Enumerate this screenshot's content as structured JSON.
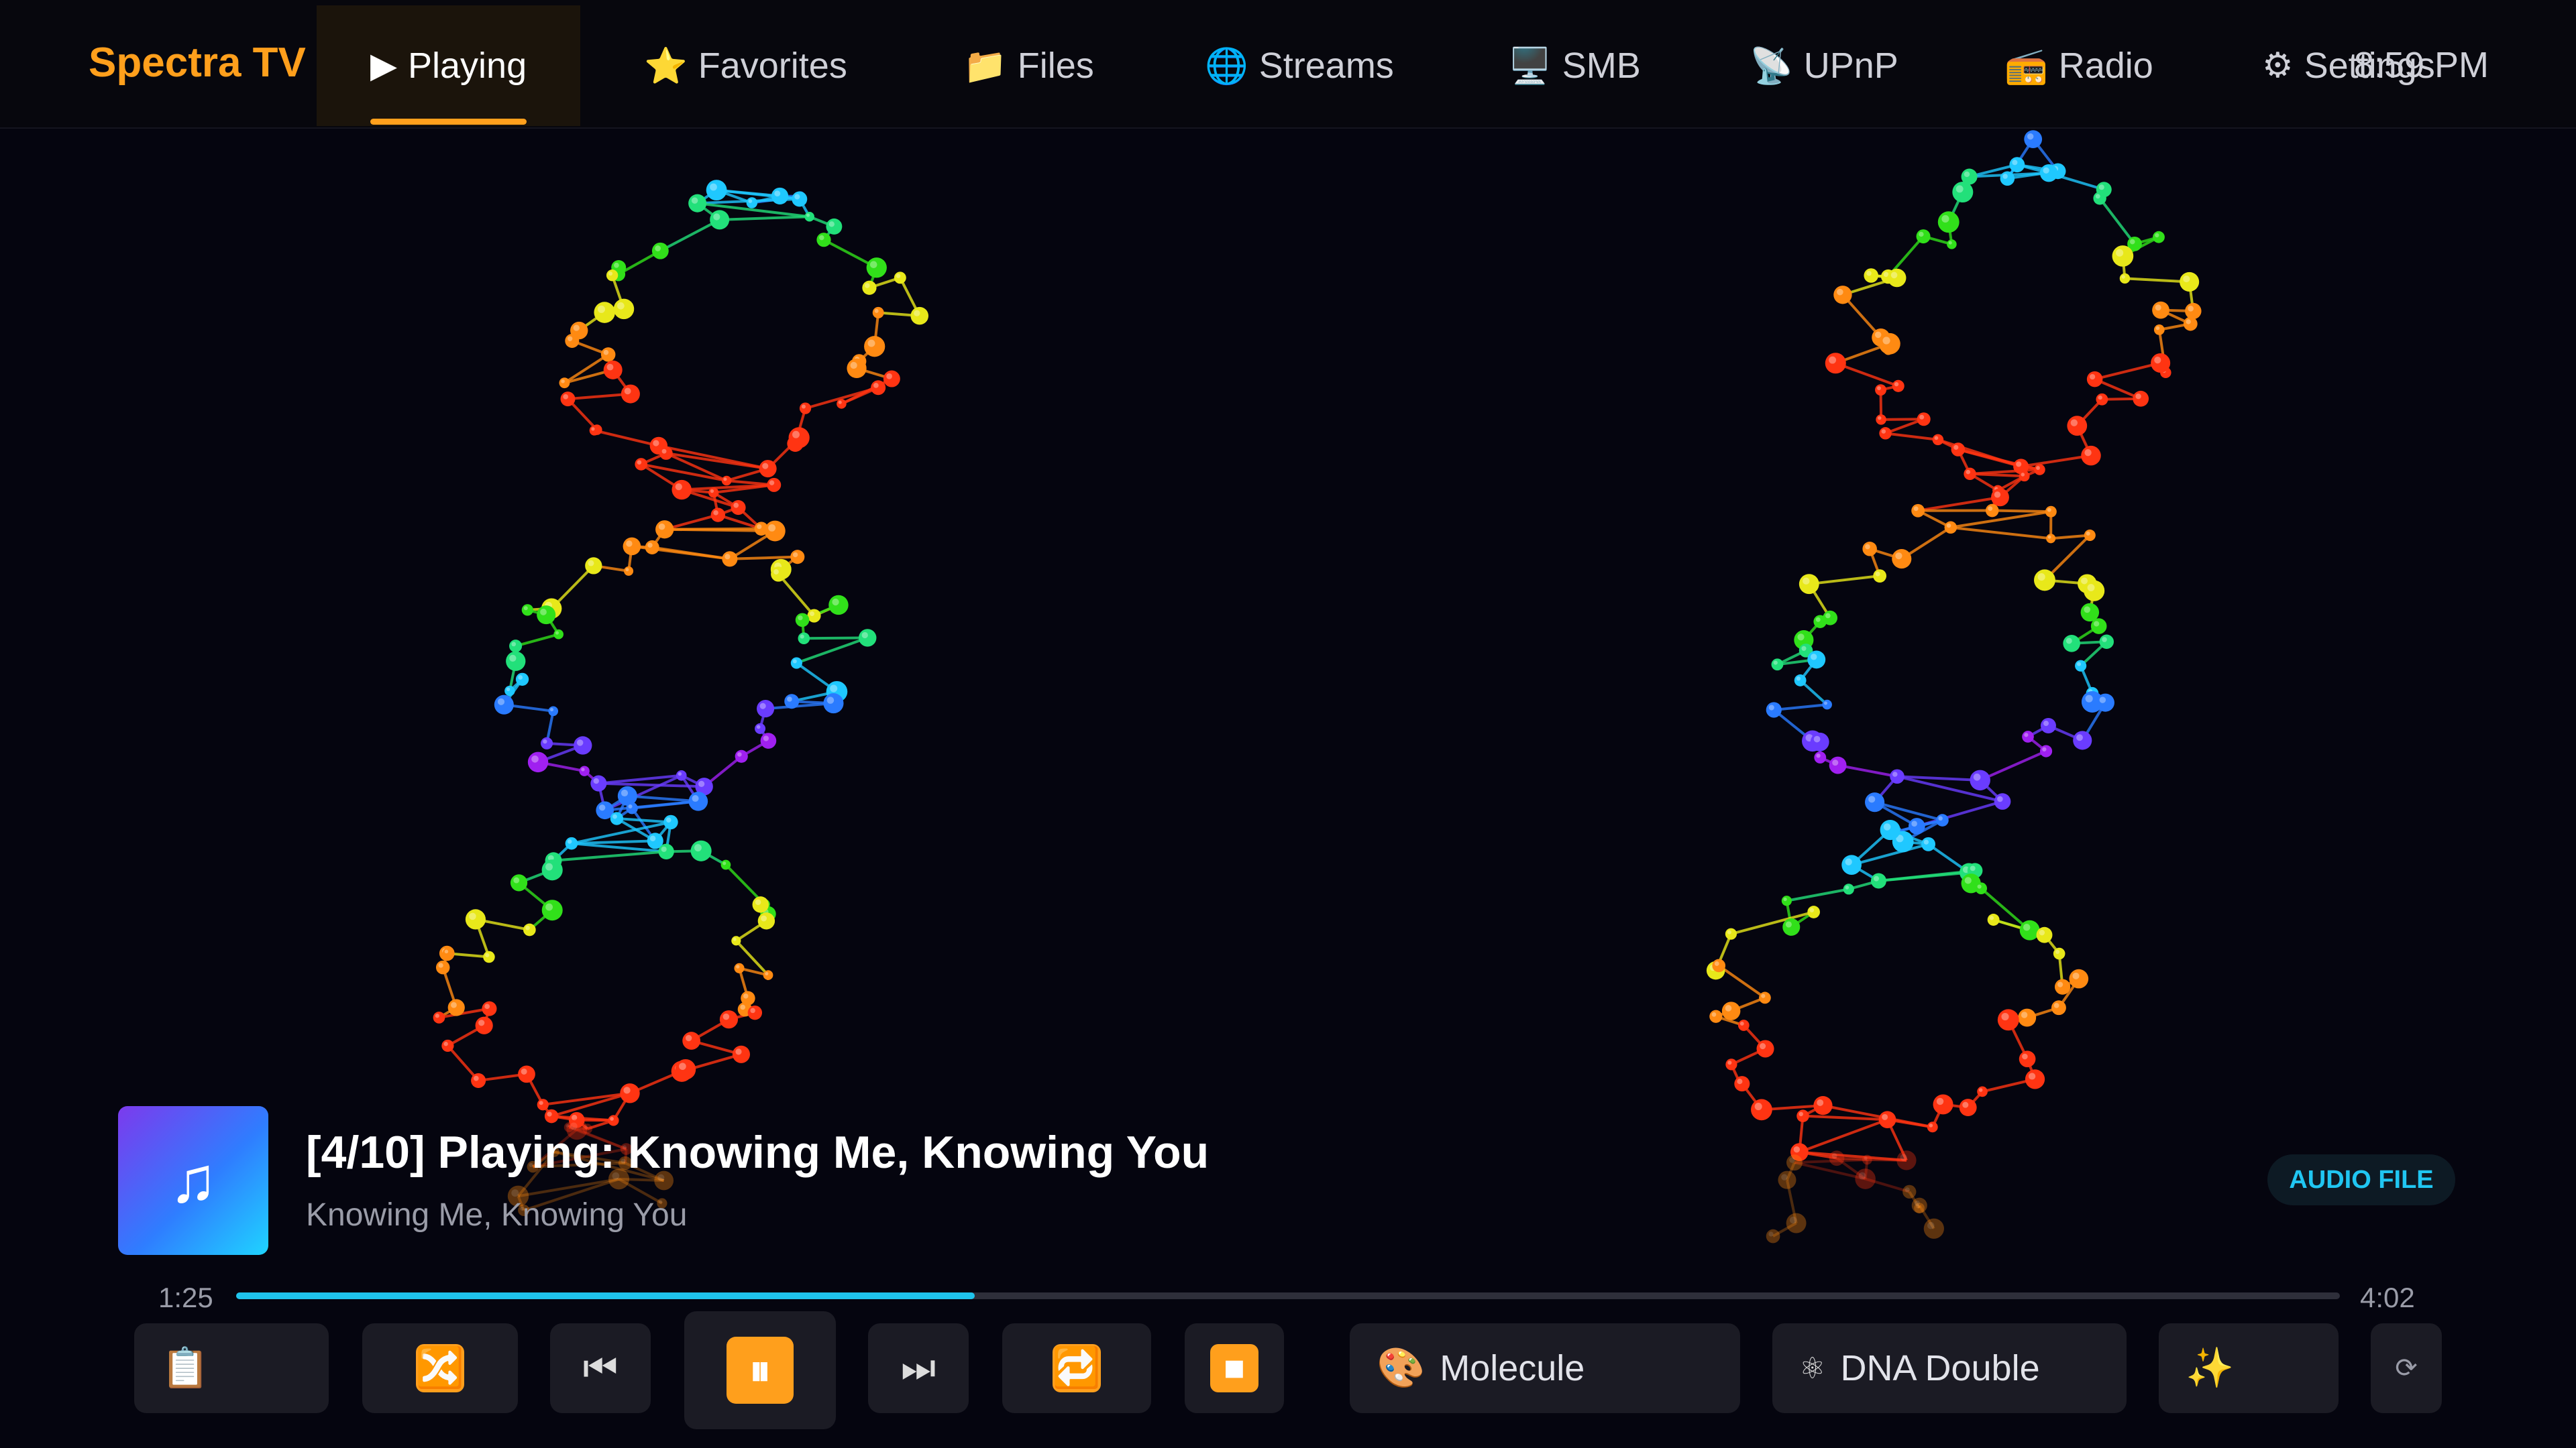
{
  "app": {
    "brand": "Spectra TV",
    "clock": "8:59 PM"
  },
  "nav": {
    "tabs": [
      {
        "icon": "▶",
        "label": "Playing",
        "active": true
      },
      {
        "icon": "⭐",
        "label": "Favorites"
      },
      {
        "icon": "📁",
        "label": "Files"
      },
      {
        "icon": "🌐",
        "label": "Streams"
      },
      {
        "icon": "🖥️",
        "label": "SMB"
      },
      {
        "icon": "📡",
        "label": "UPnP"
      },
      {
        "icon": "📻",
        "label": "Radio"
      },
      {
        "icon": "⚙",
        "label": "Settings"
      }
    ]
  },
  "now_playing": {
    "art_icon": "♫",
    "title": "[4/10] Playing: Knowing Me, Knowing You",
    "subtitle": "Knowing Me, Knowing You",
    "badge": "AUDIO FILE"
  },
  "progress": {
    "elapsed": "1:25",
    "total": "4:02",
    "fraction": 0.351
  },
  "controls": {
    "playlist_icon": "📋",
    "shuffle_icon": "🔀",
    "prev_icon": "⏮",
    "pause_icon": "⏸",
    "next_icon": "⏭",
    "repeat_icon": "🔁",
    "stop_icon": "⏹",
    "visualizer": {
      "icon": "🎨",
      "label": "Molecule"
    },
    "preset": {
      "icon": "⚛",
      "label": "DNA Double"
    },
    "effects_icon": "✨",
    "cycle_icon": "⟳"
  },
  "colors": {
    "accent": "#ff9f1c",
    "progress": "#1fc4ec",
    "background": "#05050f"
  }
}
